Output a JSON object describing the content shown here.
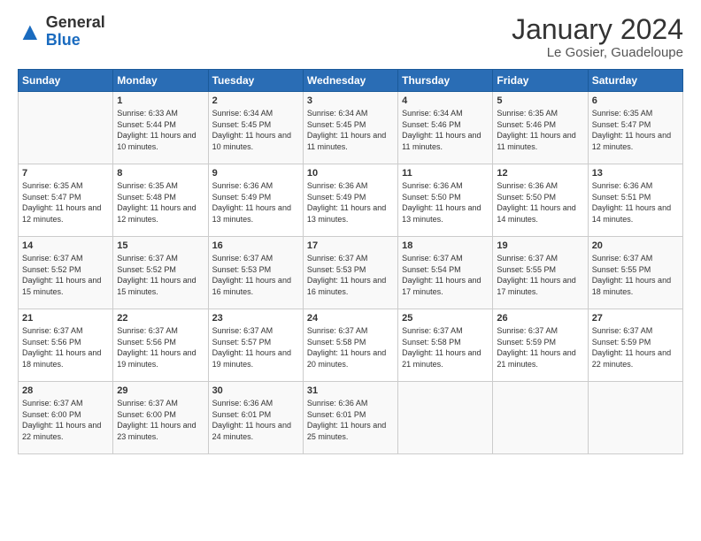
{
  "header": {
    "logo_general": "General",
    "logo_blue": "Blue",
    "month": "January 2024",
    "location": "Le Gosier, Guadeloupe"
  },
  "days_of_week": [
    "Sunday",
    "Monday",
    "Tuesday",
    "Wednesday",
    "Thursday",
    "Friday",
    "Saturday"
  ],
  "weeks": [
    [
      {
        "day": "",
        "sunrise": "",
        "sunset": "",
        "daylight": ""
      },
      {
        "day": "1",
        "sunrise": "Sunrise: 6:33 AM",
        "sunset": "Sunset: 5:44 PM",
        "daylight": "Daylight: 11 hours and 10 minutes."
      },
      {
        "day": "2",
        "sunrise": "Sunrise: 6:34 AM",
        "sunset": "Sunset: 5:45 PM",
        "daylight": "Daylight: 11 hours and 10 minutes."
      },
      {
        "day": "3",
        "sunrise": "Sunrise: 6:34 AM",
        "sunset": "Sunset: 5:45 PM",
        "daylight": "Daylight: 11 hours and 11 minutes."
      },
      {
        "day": "4",
        "sunrise": "Sunrise: 6:34 AM",
        "sunset": "Sunset: 5:46 PM",
        "daylight": "Daylight: 11 hours and 11 minutes."
      },
      {
        "day": "5",
        "sunrise": "Sunrise: 6:35 AM",
        "sunset": "Sunset: 5:46 PM",
        "daylight": "Daylight: 11 hours and 11 minutes."
      },
      {
        "day": "6",
        "sunrise": "Sunrise: 6:35 AM",
        "sunset": "Sunset: 5:47 PM",
        "daylight": "Daylight: 11 hours and 12 minutes."
      }
    ],
    [
      {
        "day": "7",
        "sunrise": "Sunrise: 6:35 AM",
        "sunset": "Sunset: 5:47 PM",
        "daylight": "Daylight: 11 hours and 12 minutes."
      },
      {
        "day": "8",
        "sunrise": "Sunrise: 6:35 AM",
        "sunset": "Sunset: 5:48 PM",
        "daylight": "Daylight: 11 hours and 12 minutes."
      },
      {
        "day": "9",
        "sunrise": "Sunrise: 6:36 AM",
        "sunset": "Sunset: 5:49 PM",
        "daylight": "Daylight: 11 hours and 13 minutes."
      },
      {
        "day": "10",
        "sunrise": "Sunrise: 6:36 AM",
        "sunset": "Sunset: 5:49 PM",
        "daylight": "Daylight: 11 hours and 13 minutes."
      },
      {
        "day": "11",
        "sunrise": "Sunrise: 6:36 AM",
        "sunset": "Sunset: 5:50 PM",
        "daylight": "Daylight: 11 hours and 13 minutes."
      },
      {
        "day": "12",
        "sunrise": "Sunrise: 6:36 AM",
        "sunset": "Sunset: 5:50 PM",
        "daylight": "Daylight: 11 hours and 14 minutes."
      },
      {
        "day": "13",
        "sunrise": "Sunrise: 6:36 AM",
        "sunset": "Sunset: 5:51 PM",
        "daylight": "Daylight: 11 hours and 14 minutes."
      }
    ],
    [
      {
        "day": "14",
        "sunrise": "Sunrise: 6:37 AM",
        "sunset": "Sunset: 5:52 PM",
        "daylight": "Daylight: 11 hours and 15 minutes."
      },
      {
        "day": "15",
        "sunrise": "Sunrise: 6:37 AM",
        "sunset": "Sunset: 5:52 PM",
        "daylight": "Daylight: 11 hours and 15 minutes."
      },
      {
        "day": "16",
        "sunrise": "Sunrise: 6:37 AM",
        "sunset": "Sunset: 5:53 PM",
        "daylight": "Daylight: 11 hours and 16 minutes."
      },
      {
        "day": "17",
        "sunrise": "Sunrise: 6:37 AM",
        "sunset": "Sunset: 5:53 PM",
        "daylight": "Daylight: 11 hours and 16 minutes."
      },
      {
        "day": "18",
        "sunrise": "Sunrise: 6:37 AM",
        "sunset": "Sunset: 5:54 PM",
        "daylight": "Daylight: 11 hours and 17 minutes."
      },
      {
        "day": "19",
        "sunrise": "Sunrise: 6:37 AM",
        "sunset": "Sunset: 5:55 PM",
        "daylight": "Daylight: 11 hours and 17 minutes."
      },
      {
        "day": "20",
        "sunrise": "Sunrise: 6:37 AM",
        "sunset": "Sunset: 5:55 PM",
        "daylight": "Daylight: 11 hours and 18 minutes."
      }
    ],
    [
      {
        "day": "21",
        "sunrise": "Sunrise: 6:37 AM",
        "sunset": "Sunset: 5:56 PM",
        "daylight": "Daylight: 11 hours and 18 minutes."
      },
      {
        "day": "22",
        "sunrise": "Sunrise: 6:37 AM",
        "sunset": "Sunset: 5:56 PM",
        "daylight": "Daylight: 11 hours and 19 minutes."
      },
      {
        "day": "23",
        "sunrise": "Sunrise: 6:37 AM",
        "sunset": "Sunset: 5:57 PM",
        "daylight": "Daylight: 11 hours and 19 minutes."
      },
      {
        "day": "24",
        "sunrise": "Sunrise: 6:37 AM",
        "sunset": "Sunset: 5:58 PM",
        "daylight": "Daylight: 11 hours and 20 minutes."
      },
      {
        "day": "25",
        "sunrise": "Sunrise: 6:37 AM",
        "sunset": "Sunset: 5:58 PM",
        "daylight": "Daylight: 11 hours and 21 minutes."
      },
      {
        "day": "26",
        "sunrise": "Sunrise: 6:37 AM",
        "sunset": "Sunset: 5:59 PM",
        "daylight": "Daylight: 11 hours and 21 minutes."
      },
      {
        "day": "27",
        "sunrise": "Sunrise: 6:37 AM",
        "sunset": "Sunset: 5:59 PM",
        "daylight": "Daylight: 11 hours and 22 minutes."
      }
    ],
    [
      {
        "day": "28",
        "sunrise": "Sunrise: 6:37 AM",
        "sunset": "Sunset: 6:00 PM",
        "daylight": "Daylight: 11 hours and 22 minutes."
      },
      {
        "day": "29",
        "sunrise": "Sunrise: 6:37 AM",
        "sunset": "Sunset: 6:00 PM",
        "daylight": "Daylight: 11 hours and 23 minutes."
      },
      {
        "day": "30",
        "sunrise": "Sunrise: 6:36 AM",
        "sunset": "Sunset: 6:01 PM",
        "daylight": "Daylight: 11 hours and 24 minutes."
      },
      {
        "day": "31",
        "sunrise": "Sunrise: 6:36 AM",
        "sunset": "Sunset: 6:01 PM",
        "daylight": "Daylight: 11 hours and 25 minutes."
      },
      {
        "day": "",
        "sunrise": "",
        "sunset": "",
        "daylight": ""
      },
      {
        "day": "",
        "sunrise": "",
        "sunset": "",
        "daylight": ""
      },
      {
        "day": "",
        "sunrise": "",
        "sunset": "",
        "daylight": ""
      }
    ]
  ]
}
